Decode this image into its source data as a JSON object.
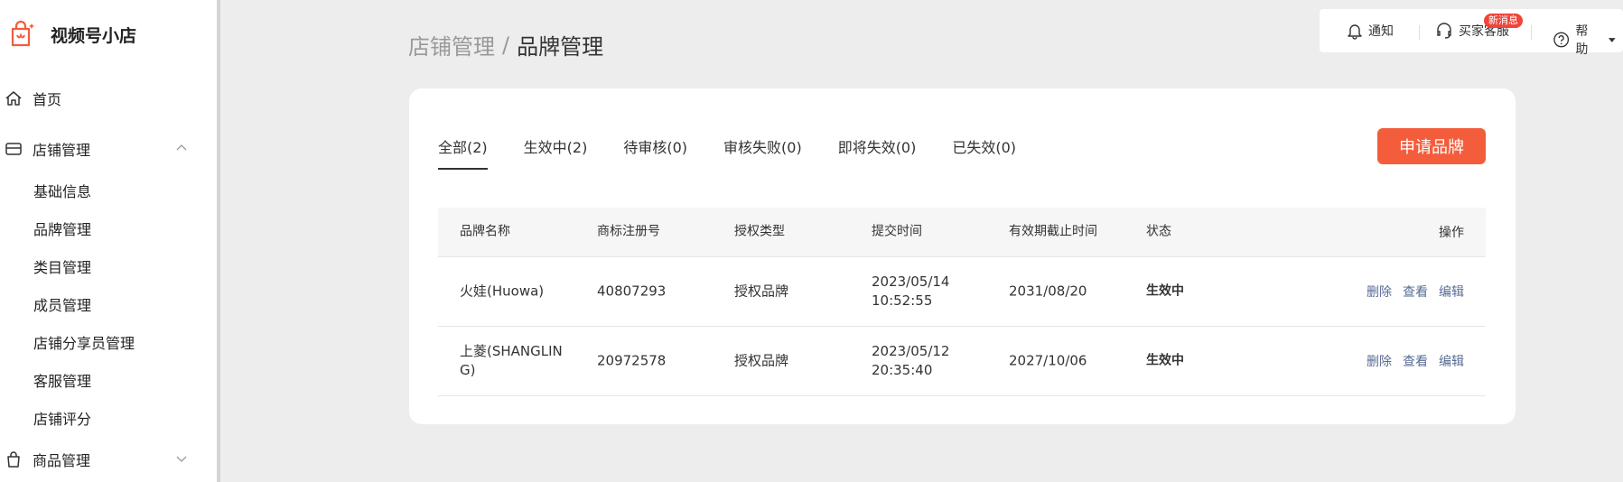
{
  "app": {
    "title": "视频号小店"
  },
  "sidebar": {
    "home": "首页",
    "store": {
      "label": "店铺管理",
      "items": [
        "基础信息",
        "品牌管理",
        "类目管理",
        "成员管理",
        "店铺分享员管理",
        "客服管理",
        "店铺评分"
      ]
    },
    "goods": "商品管理"
  },
  "topbar": {
    "notify": "通知",
    "feedback": "买家客服",
    "badge": "新消息",
    "help": "帮助"
  },
  "breadcrumb": {
    "parent": "店铺管理",
    "separator": "/",
    "current": "品牌管理"
  },
  "tabs": [
    "全部(2)",
    "生效中(2)",
    "待审核(0)",
    "审核失败(0)",
    "即将失效(0)",
    "已失效(0)"
  ],
  "apply_button": "申请品牌",
  "table": {
    "headers": [
      "品牌名称",
      "商标注册号",
      "授权类型",
      "提交时间",
      "有效期截止时间",
      "状态",
      "操作"
    ],
    "rows": [
      {
        "name": "火娃(Huowa)",
        "reg_no": "40807293",
        "auth_type": "授权品牌",
        "submit_time": "2023/05/14 10:52:55",
        "expire": "2031/08/20",
        "status": "生效中"
      },
      {
        "name": "上菱(SHANGLING)",
        "reg_no": "20972578",
        "auth_type": "授权品牌",
        "submit_time": "2023/05/12 20:35:40",
        "expire": "2027/10/06",
        "status": "生效中"
      }
    ],
    "actions": [
      "删除",
      "查看",
      "编辑"
    ]
  },
  "colors": {
    "accent": "#f45d3b",
    "link": "#576b95",
    "badge": "#f0453a"
  }
}
